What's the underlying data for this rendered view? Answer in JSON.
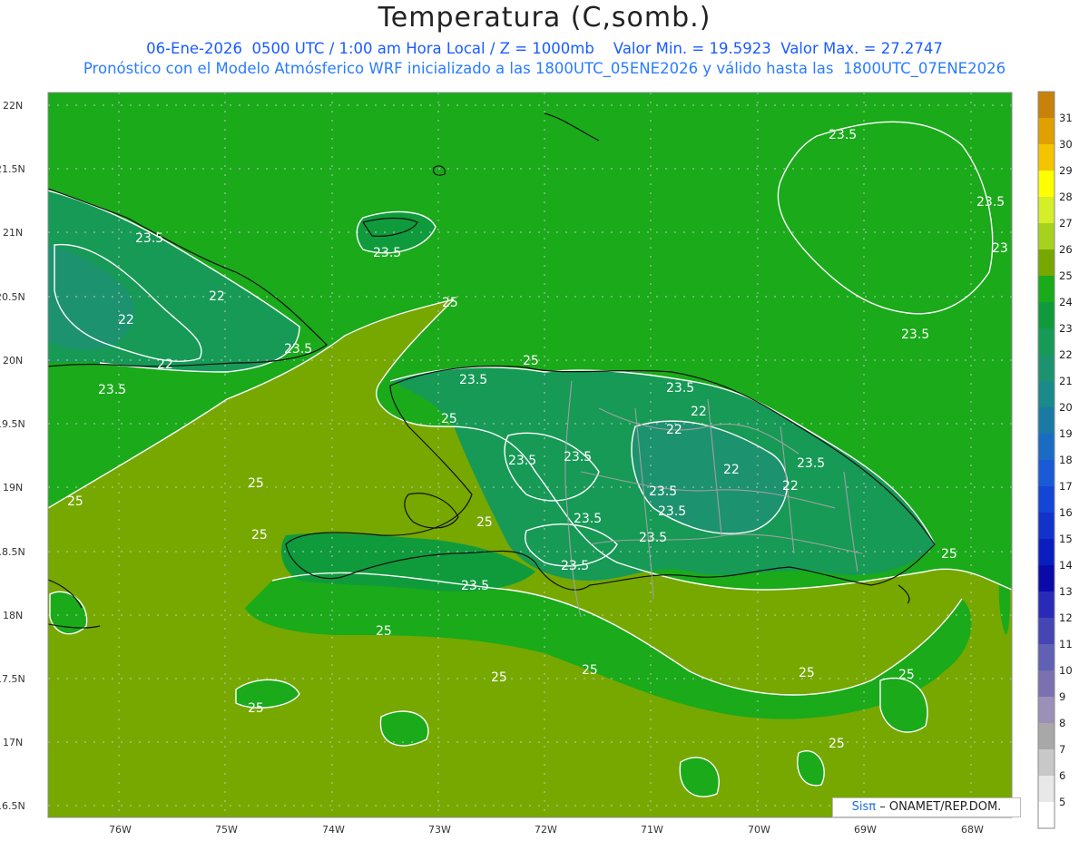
{
  "header": {
    "title": "Temperatura (C,somb.)",
    "line1": "06-Ene-2026  0500 UTC / 1:00 am Hora Local / Z = 1000mb    Valor Min. = 19.5923  Valor Max. = 27.2747",
    "line2": "Pronóstico con el Modelo Atmósferico WRF inicializado a las 1800UTC_05ENE2026 y válido hasta las  1800UTC_07ENE2026"
  },
  "axes": {
    "lat_labels": [
      "22N",
      "21.5N",
      "21N",
      "20.5N",
      "20N",
      "19.5N",
      "19N",
      "18.5N",
      "18N",
      "17.5N",
      "17N",
      "16.5N"
    ],
    "lon_labels": [
      "76W",
      "75W",
      "74W",
      "73W",
      "72W",
      "71W",
      "70W",
      "69W",
      "68W"
    ]
  },
  "contour_labels": [
    "23.5",
    "23.5",
    "23.5",
    "23",
    "23.5",
    "23.5",
    "22",
    "22",
    "22",
    "23.5",
    "23.5",
    "25",
    "25",
    "23.5",
    "25",
    "23.5",
    "22",
    "22",
    "23.5",
    "23.5",
    "22",
    "23.5",
    "25",
    "25",
    "23.5",
    "23.5",
    "25",
    "23.5",
    "23.5",
    "25",
    "25",
    "25",
    "25",
    "25",
    "25",
    "25",
    "23.5",
    "22",
    "25",
    "25",
    "23.5"
  ],
  "colorbar": {
    "labels": [
      "31",
      "30",
      "29",
      "28",
      "27",
      "26",
      "25",
      "24",
      "23",
      "22",
      "21",
      "20",
      "19",
      "18",
      "17",
      "16",
      "15",
      "14",
      "13",
      "12",
      "11",
      "10",
      "9",
      "8",
      "7",
      "6",
      "5"
    ],
    "colors": [
      "#c8820a",
      "#e0a000",
      "#f5c400",
      "#ffff00",
      "#d4ee2a",
      "#a6d21e",
      "#76a800",
      "#1aaa1a",
      "#0f9b3c",
      "#169a56",
      "#1d926e",
      "#1a8a8a",
      "#1a7aa4",
      "#1a6cc2",
      "#1a5ad6",
      "#1446d6",
      "#1232cc",
      "#0a1ec0",
      "#0a0aa8",
      "#2a2ab8",
      "#4545b4",
      "#6060b4",
      "#7b70b0",
      "#9a90b8",
      "#a8a8a8",
      "#c8c8c8",
      "#e8e8e8",
      "#ffffff"
    ]
  },
  "credit": {
    "brand": "Sisπ",
    "text": "– ONAMET/REP.DOM."
  }
}
